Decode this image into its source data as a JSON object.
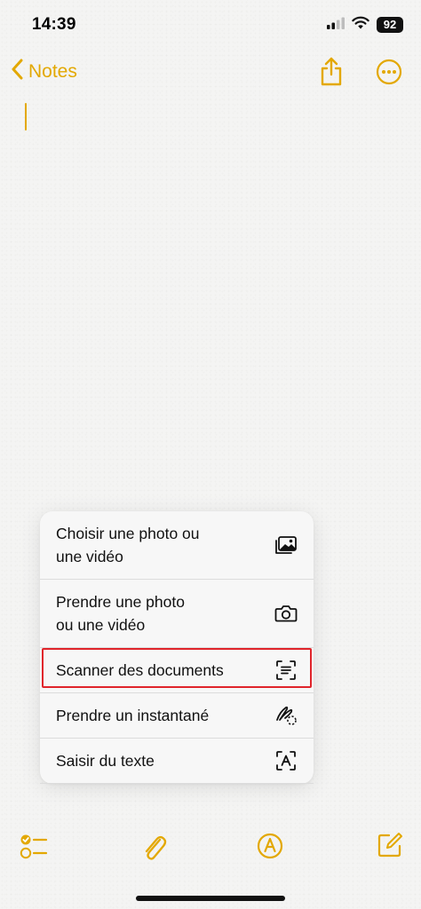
{
  "status_bar": {
    "time": "14:39",
    "battery": "92"
  },
  "nav": {
    "back_label": "Notes"
  },
  "menu": {
    "items": [
      {
        "label": "Choisir une photo ou\nune vidéo",
        "icon": "photo-library-icon"
      },
      {
        "label": "Prendre une photo\nou une vidéo",
        "icon": "camera-icon"
      },
      {
        "label": "Scanner des documents",
        "icon": "doc-scan-icon"
      },
      {
        "label": "Prendre un instantané",
        "icon": "sketch-lasso-icon"
      },
      {
        "label": "Saisir du texte",
        "icon": "text-scan-icon"
      }
    ],
    "highlighted_index": 2
  },
  "colors": {
    "accent": "#e3a800",
    "highlight_border": "#e0242b",
    "background": "#f4f4f3",
    "menu_background": "#f7f7f7"
  },
  "toolbar": {
    "icons": [
      "checklist-icon",
      "paperclip-icon",
      "markup-icon",
      "compose-icon"
    ]
  }
}
